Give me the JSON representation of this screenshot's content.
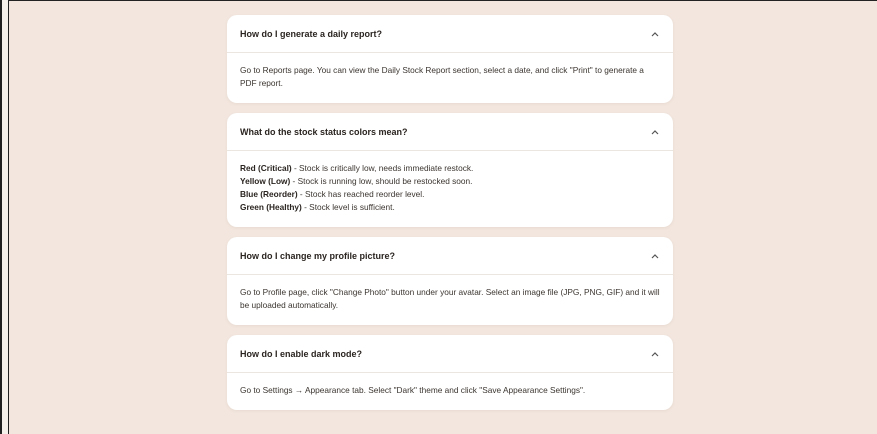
{
  "faq": [
    {
      "question": "How do I generate a daily report?",
      "answer": "Go to Reports page. You can view the Daily Stock Report section, select a date, and click \"Print\" to generate a PDF report."
    },
    {
      "question": "What do the stock status colors mean?",
      "statuses": [
        {
          "label": "Red (Critical)",
          "text": " - Stock is critically low, needs immediate restock."
        },
        {
          "label": "Yellow (Low)",
          "text": " - Stock is running low, should be restocked soon."
        },
        {
          "label": "Blue (Reorder)",
          "text": " - Stock has reached reorder level."
        },
        {
          "label": "Green (Healthy)",
          "text": " - Stock level is sufficient."
        }
      ]
    },
    {
      "question": "How do I change my profile picture?",
      "answer": "Go to Profile page, click \"Change Photo\" button under your avatar. Select an image file (JPG, PNG, GIF) and it will be uploaded automatically."
    },
    {
      "question": "How do I enable dark mode?",
      "answer": "Go to Settings → Appearance tab. Select \"Dark\" theme and click \"Save Appearance Settings\"."
    }
  ],
  "icons": {
    "toggle": "chevron-up-icon"
  },
  "colors": {
    "background": "#f2e6de",
    "card": "#ffffff"
  }
}
